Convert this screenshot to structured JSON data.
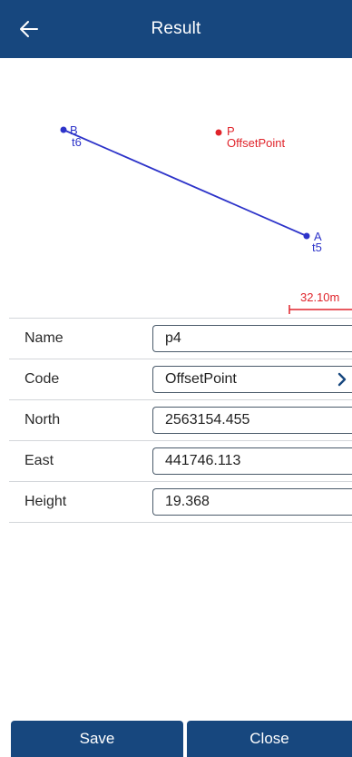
{
  "header": {
    "title": "Result"
  },
  "map": {
    "points": {
      "B": {
        "name": "B",
        "code": "t6"
      },
      "A": {
        "name": "A",
        "code": "t5"
      },
      "P": {
        "name": "P",
        "code": "OffsetPoint"
      }
    },
    "scale_label": "32.10m",
    "colors": {
      "line": "#2d33c9",
      "target": "#e0242b"
    }
  },
  "form": {
    "fields": [
      {
        "label": "Name",
        "value": "p4"
      },
      {
        "label": "Code",
        "value": "OffsetPoint"
      },
      {
        "label": "North",
        "value": "2563154.455"
      },
      {
        "label": "East",
        "value": "441746.113"
      },
      {
        "label": "Height",
        "value": "19.368"
      }
    ]
  },
  "buttons": {
    "save": "Save",
    "close": "Close"
  },
  "icons": {
    "back": "arrow-left-icon",
    "code_picker": "chevron-right-icon"
  },
  "colors": {
    "brand": "#17477e"
  }
}
